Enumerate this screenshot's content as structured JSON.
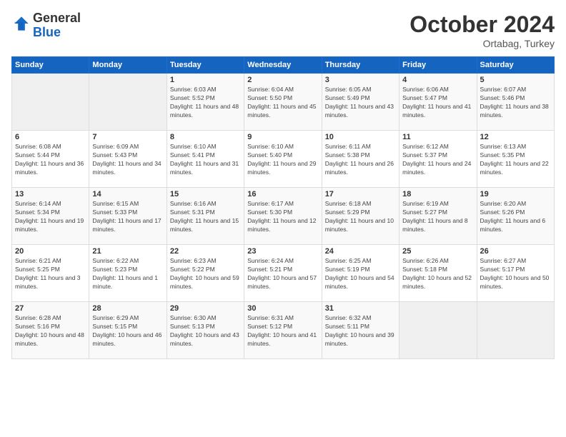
{
  "logo": {
    "general": "General",
    "blue": "Blue"
  },
  "header": {
    "month": "October 2024",
    "location": "Ortabag, Turkey"
  },
  "weekdays": [
    "Sunday",
    "Monday",
    "Tuesday",
    "Wednesday",
    "Thursday",
    "Friday",
    "Saturday"
  ],
  "weeks": [
    [
      {
        "day": "",
        "empty": true
      },
      {
        "day": "",
        "empty": true
      },
      {
        "day": "1",
        "sunrise": "Sunrise: 6:03 AM",
        "sunset": "Sunset: 5:52 PM",
        "daylight": "Daylight: 11 hours and 48 minutes."
      },
      {
        "day": "2",
        "sunrise": "Sunrise: 6:04 AM",
        "sunset": "Sunset: 5:50 PM",
        "daylight": "Daylight: 11 hours and 45 minutes."
      },
      {
        "day": "3",
        "sunrise": "Sunrise: 6:05 AM",
        "sunset": "Sunset: 5:49 PM",
        "daylight": "Daylight: 11 hours and 43 minutes."
      },
      {
        "day": "4",
        "sunrise": "Sunrise: 6:06 AM",
        "sunset": "Sunset: 5:47 PM",
        "daylight": "Daylight: 11 hours and 41 minutes."
      },
      {
        "day": "5",
        "sunrise": "Sunrise: 6:07 AM",
        "sunset": "Sunset: 5:46 PM",
        "daylight": "Daylight: 11 hours and 38 minutes."
      }
    ],
    [
      {
        "day": "6",
        "sunrise": "Sunrise: 6:08 AM",
        "sunset": "Sunset: 5:44 PM",
        "daylight": "Daylight: 11 hours and 36 minutes."
      },
      {
        "day": "7",
        "sunrise": "Sunrise: 6:09 AM",
        "sunset": "Sunset: 5:43 PM",
        "daylight": "Daylight: 11 hours and 34 minutes."
      },
      {
        "day": "8",
        "sunrise": "Sunrise: 6:10 AM",
        "sunset": "Sunset: 5:41 PM",
        "daylight": "Daylight: 11 hours and 31 minutes."
      },
      {
        "day": "9",
        "sunrise": "Sunrise: 6:10 AM",
        "sunset": "Sunset: 5:40 PM",
        "daylight": "Daylight: 11 hours and 29 minutes."
      },
      {
        "day": "10",
        "sunrise": "Sunrise: 6:11 AM",
        "sunset": "Sunset: 5:38 PM",
        "daylight": "Daylight: 11 hours and 26 minutes."
      },
      {
        "day": "11",
        "sunrise": "Sunrise: 6:12 AM",
        "sunset": "Sunset: 5:37 PM",
        "daylight": "Daylight: 11 hours and 24 minutes."
      },
      {
        "day": "12",
        "sunrise": "Sunrise: 6:13 AM",
        "sunset": "Sunset: 5:35 PM",
        "daylight": "Daylight: 11 hours and 22 minutes."
      }
    ],
    [
      {
        "day": "13",
        "sunrise": "Sunrise: 6:14 AM",
        "sunset": "Sunset: 5:34 PM",
        "daylight": "Daylight: 11 hours and 19 minutes."
      },
      {
        "day": "14",
        "sunrise": "Sunrise: 6:15 AM",
        "sunset": "Sunset: 5:33 PM",
        "daylight": "Daylight: 11 hours and 17 minutes."
      },
      {
        "day": "15",
        "sunrise": "Sunrise: 6:16 AM",
        "sunset": "Sunset: 5:31 PM",
        "daylight": "Daylight: 11 hours and 15 minutes."
      },
      {
        "day": "16",
        "sunrise": "Sunrise: 6:17 AM",
        "sunset": "Sunset: 5:30 PM",
        "daylight": "Daylight: 11 hours and 12 minutes."
      },
      {
        "day": "17",
        "sunrise": "Sunrise: 6:18 AM",
        "sunset": "Sunset: 5:29 PM",
        "daylight": "Daylight: 11 hours and 10 minutes."
      },
      {
        "day": "18",
        "sunrise": "Sunrise: 6:19 AM",
        "sunset": "Sunset: 5:27 PM",
        "daylight": "Daylight: 11 hours and 8 minutes."
      },
      {
        "day": "19",
        "sunrise": "Sunrise: 6:20 AM",
        "sunset": "Sunset: 5:26 PM",
        "daylight": "Daylight: 11 hours and 6 minutes."
      }
    ],
    [
      {
        "day": "20",
        "sunrise": "Sunrise: 6:21 AM",
        "sunset": "Sunset: 5:25 PM",
        "daylight": "Daylight: 11 hours and 3 minutes."
      },
      {
        "day": "21",
        "sunrise": "Sunrise: 6:22 AM",
        "sunset": "Sunset: 5:23 PM",
        "daylight": "Daylight: 11 hours and 1 minute."
      },
      {
        "day": "22",
        "sunrise": "Sunrise: 6:23 AM",
        "sunset": "Sunset: 5:22 PM",
        "daylight": "Daylight: 10 hours and 59 minutes."
      },
      {
        "day": "23",
        "sunrise": "Sunrise: 6:24 AM",
        "sunset": "Sunset: 5:21 PM",
        "daylight": "Daylight: 10 hours and 57 minutes."
      },
      {
        "day": "24",
        "sunrise": "Sunrise: 6:25 AM",
        "sunset": "Sunset: 5:19 PM",
        "daylight": "Daylight: 10 hours and 54 minutes."
      },
      {
        "day": "25",
        "sunrise": "Sunrise: 6:26 AM",
        "sunset": "Sunset: 5:18 PM",
        "daylight": "Daylight: 10 hours and 52 minutes."
      },
      {
        "day": "26",
        "sunrise": "Sunrise: 6:27 AM",
        "sunset": "Sunset: 5:17 PM",
        "daylight": "Daylight: 10 hours and 50 minutes."
      }
    ],
    [
      {
        "day": "27",
        "sunrise": "Sunrise: 6:28 AM",
        "sunset": "Sunset: 5:16 PM",
        "daylight": "Daylight: 10 hours and 48 minutes."
      },
      {
        "day": "28",
        "sunrise": "Sunrise: 6:29 AM",
        "sunset": "Sunset: 5:15 PM",
        "daylight": "Daylight: 10 hours and 46 minutes."
      },
      {
        "day": "29",
        "sunrise": "Sunrise: 6:30 AM",
        "sunset": "Sunset: 5:13 PM",
        "daylight": "Daylight: 10 hours and 43 minutes."
      },
      {
        "day": "30",
        "sunrise": "Sunrise: 6:31 AM",
        "sunset": "Sunset: 5:12 PM",
        "daylight": "Daylight: 10 hours and 41 minutes."
      },
      {
        "day": "31",
        "sunrise": "Sunrise: 6:32 AM",
        "sunset": "Sunset: 5:11 PM",
        "daylight": "Daylight: 10 hours and 39 minutes."
      },
      {
        "day": "",
        "empty": true
      },
      {
        "day": "",
        "empty": true
      }
    ]
  ]
}
